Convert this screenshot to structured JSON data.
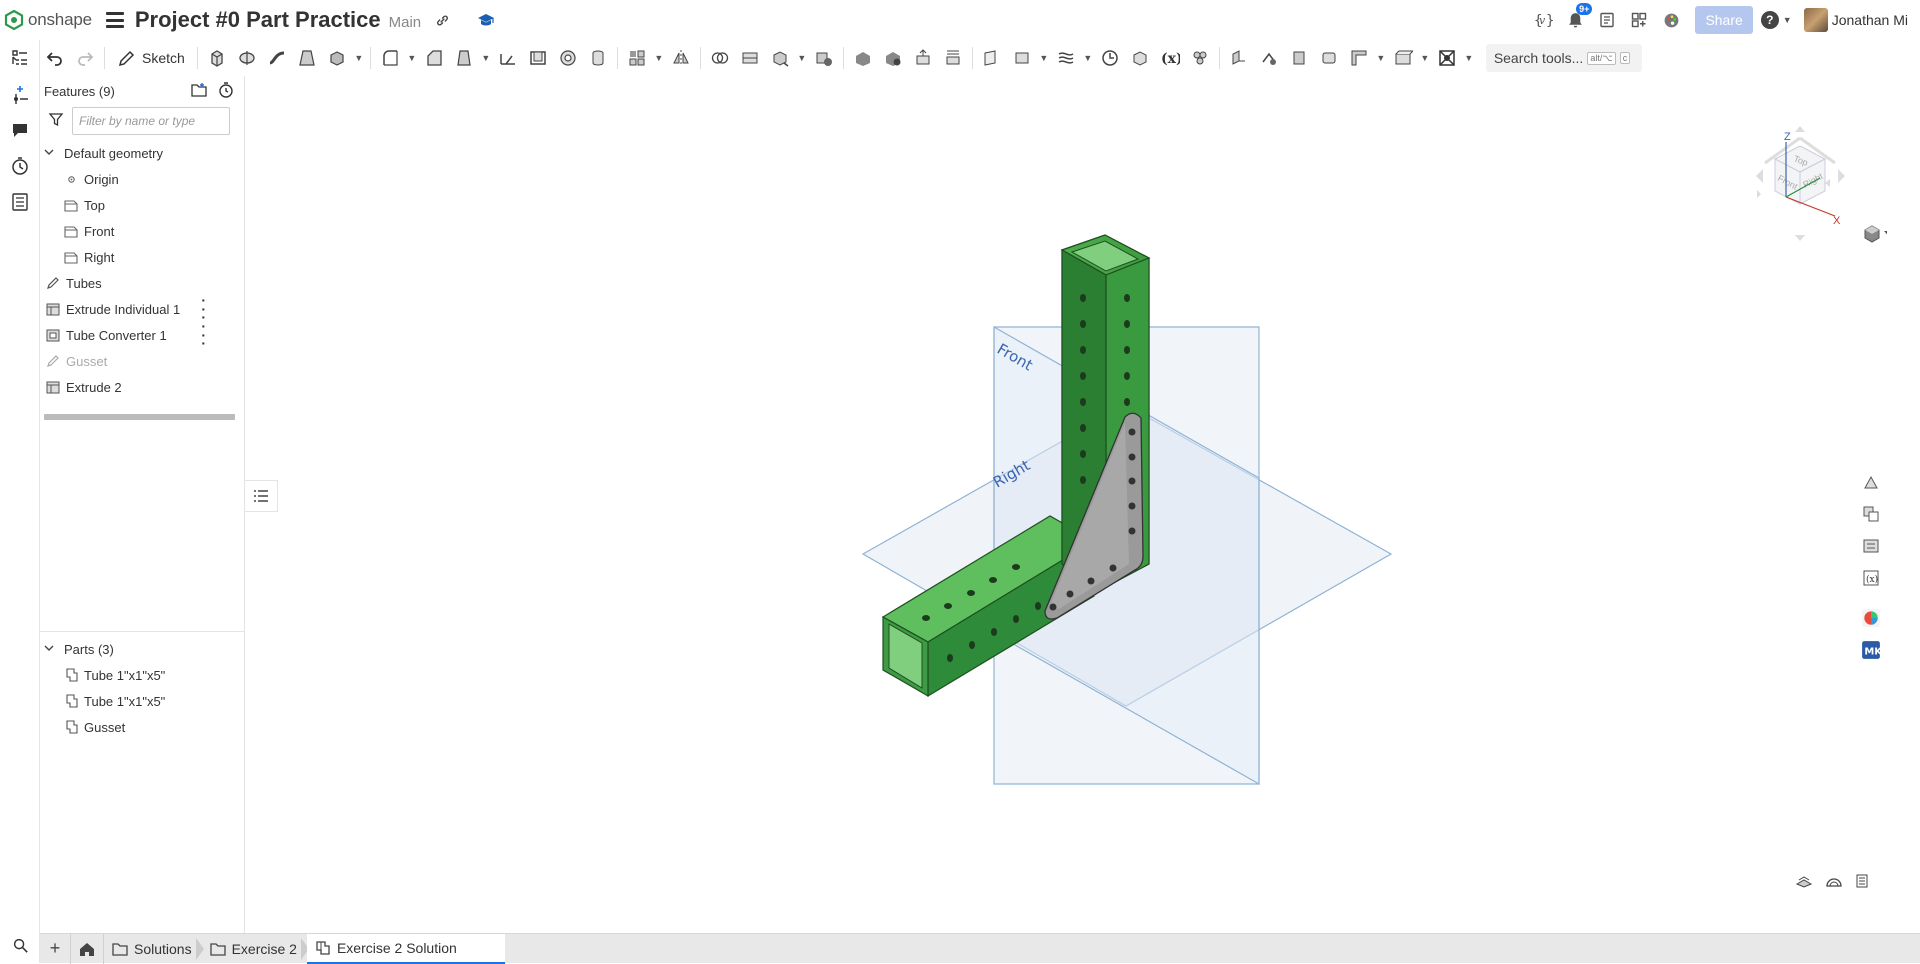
{
  "app": {
    "brand": "onshape",
    "document_title": "Project #0 Part Practice",
    "workspace": "Main",
    "share_label": "Share",
    "notification_count": "9+",
    "user_name": "Jonathan Mi",
    "accent_color": "#1a73e8",
    "part_green": "#2e8b3a"
  },
  "toolbar": {
    "sketch_label": "Sketch",
    "search_label": "Search tools...",
    "search_shortcut_1": "alt/⌥",
    "search_shortcut_2": "c"
  },
  "features": {
    "header": "Features (9)",
    "filter_placeholder": "Filter by name or type",
    "default_geometry": "Default geometry",
    "items_default": [
      {
        "label": "Origin",
        "icon": "origin-icon"
      },
      {
        "label": "Top",
        "icon": "plane-icon"
      },
      {
        "label": "Front",
        "icon": "plane-icon"
      },
      {
        "label": "Right",
        "icon": "plane-icon"
      }
    ],
    "items": [
      {
        "label": "Tubes",
        "icon": "sketch-icon"
      },
      {
        "label": "Extrude Individual 1",
        "icon": "extrude-icon"
      },
      {
        "label": "Tube Converter 1",
        "icon": "custom-feature-icon"
      },
      {
        "label": "Gusset",
        "icon": "sketch-icon"
      },
      {
        "label": "Extrude 2",
        "icon": "extrude-icon"
      }
    ]
  },
  "parts": {
    "header": "Parts (3)",
    "items": [
      "Tube 1\"x1\"x5\"",
      "Tube 1\"x1\"x5\"",
      "Gusset"
    ]
  },
  "viewport": {
    "plane_front": "Front",
    "plane_right": "Right",
    "cube_top": "Top",
    "cube_front": "Front",
    "cube_right": "Right",
    "axis_z": "Z",
    "axis_x": "X"
  },
  "tabs": {
    "folder_1": "Solutions",
    "folder_2": "Exercise 2",
    "active": "Exercise 2 Solution"
  }
}
